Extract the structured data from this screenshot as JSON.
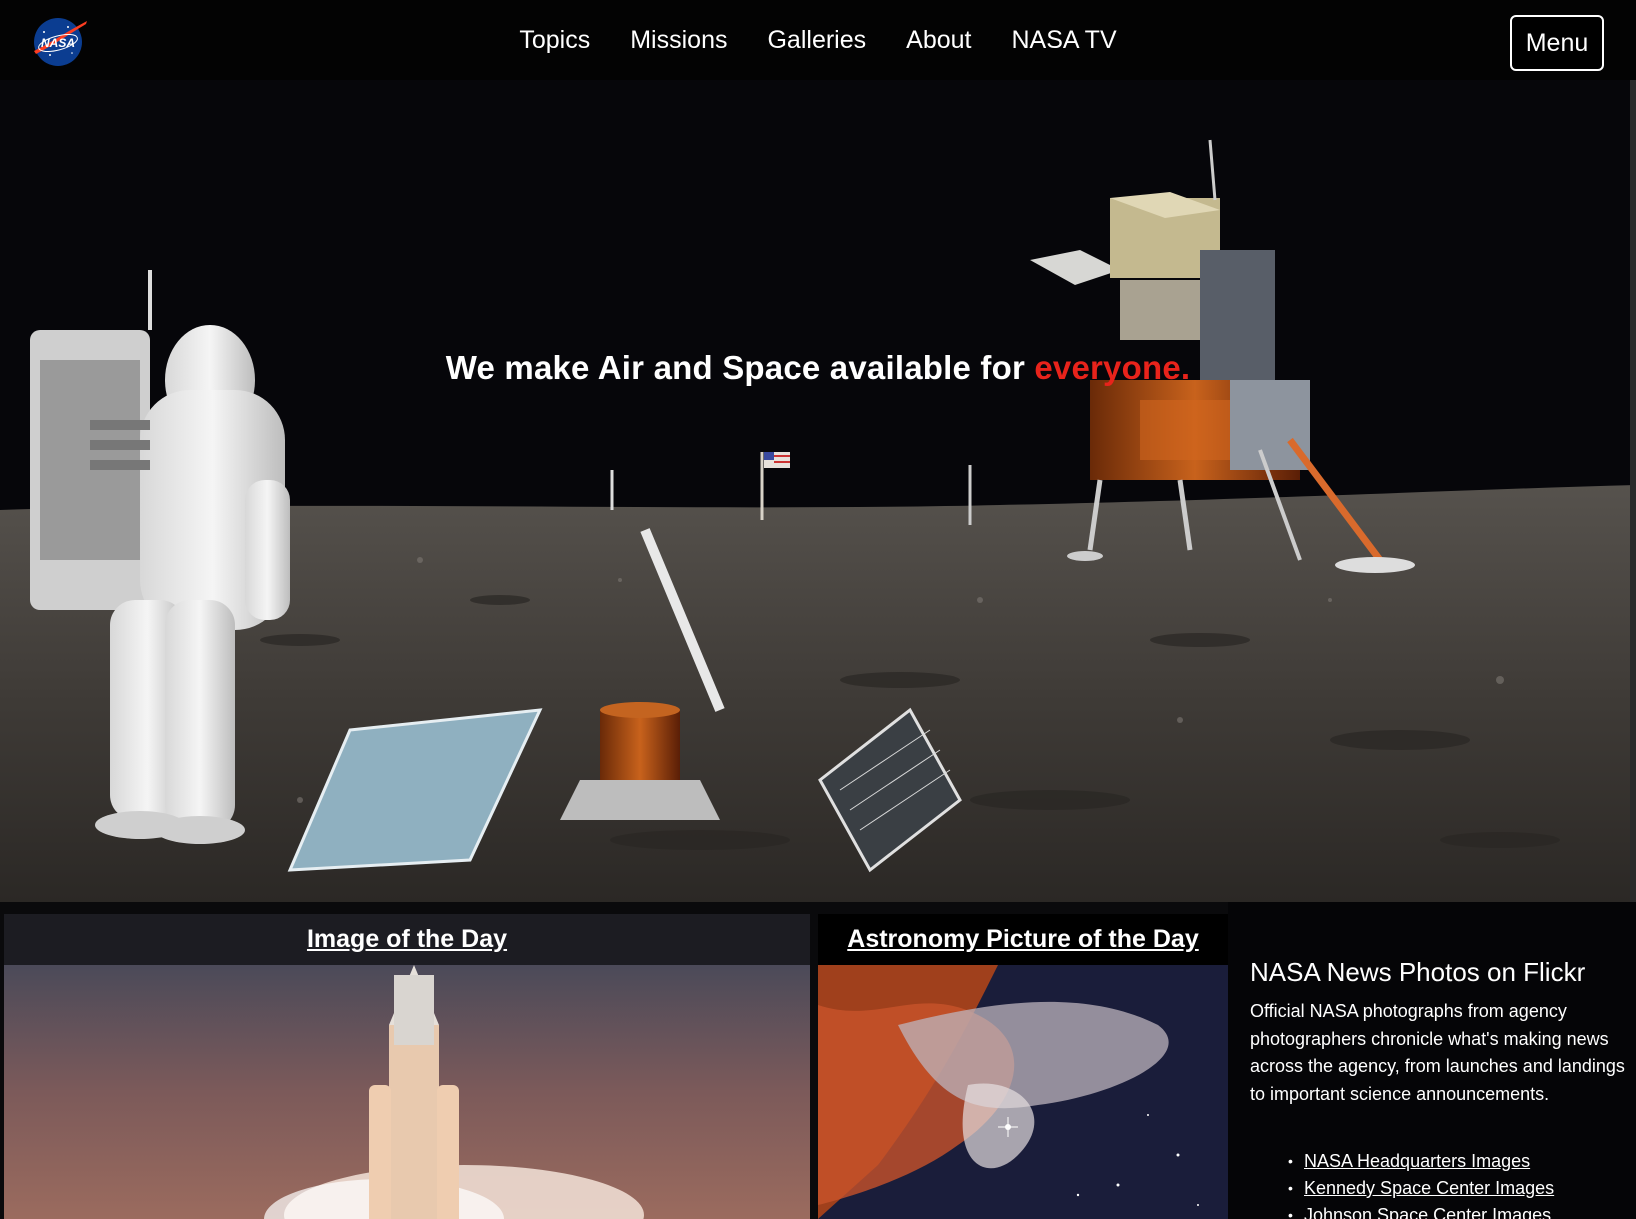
{
  "header": {
    "logo_text": "NASA",
    "nav": [
      {
        "label": "Topics"
      },
      {
        "label": "Missions"
      },
      {
        "label": "Galleries"
      },
      {
        "label": "About"
      },
      {
        "label": "NASA TV"
      }
    ],
    "menu_label": "Menu"
  },
  "hero": {
    "tagline_main": "We make Air and Space available for ",
    "tagline_accent": "everyone.",
    "accent_color": "#e8231b"
  },
  "cards": {
    "image_of_the_day": {
      "title": "Image of the Day"
    },
    "apod": {
      "title": "Astronomy Picture of the Day"
    }
  },
  "flickr": {
    "title": "NASA News Photos on Flickr",
    "description": "Official NASA photographs from agency photographers chronicle what's making news across the agency, from launches and landings to important science announcements.",
    "links": [
      {
        "label": "NASA Headquarters Images"
      },
      {
        "label": "Kennedy Space Center Images"
      },
      {
        "label": "Johnson Space Center Images"
      }
    ]
  }
}
